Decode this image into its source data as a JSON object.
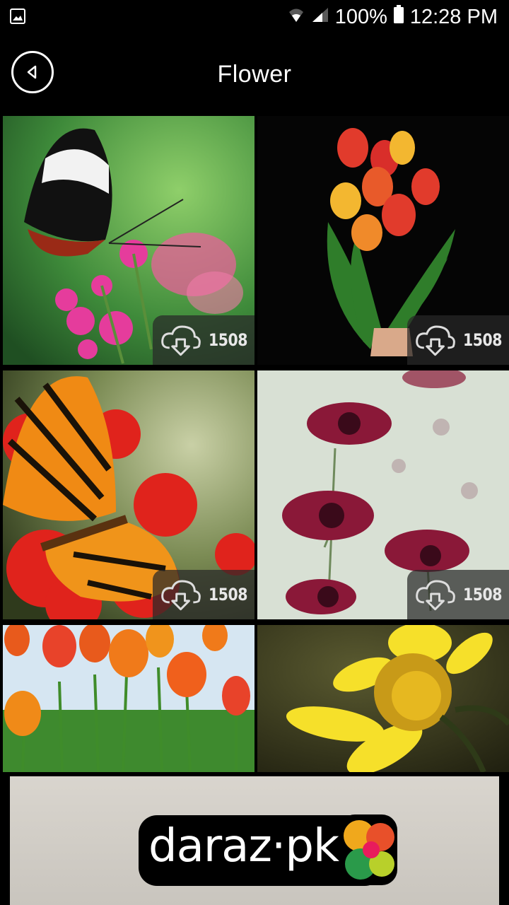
{
  "status_bar": {
    "battery": "100%",
    "time": "12:28 PM"
  },
  "header": {
    "title": "Flower"
  },
  "gallery": {
    "items": [
      {
        "subject": "butterfly on pink flowers",
        "downloads": "1508"
      },
      {
        "subject": "tulip bouquet",
        "downloads": "1508"
      },
      {
        "subject": "orange butterfly on red flowers",
        "downloads": "1508"
      },
      {
        "subject": "purple cosmos flowers",
        "downloads": "1508"
      },
      {
        "subject": "orange tulips field",
        "downloads": ""
      },
      {
        "subject": "yellow flower",
        "downloads": ""
      }
    ]
  },
  "ad": {
    "brand": "daraz·pk"
  },
  "colors": {
    "background": "#000000",
    "badge": "#282828",
    "text": "#ffffff"
  }
}
